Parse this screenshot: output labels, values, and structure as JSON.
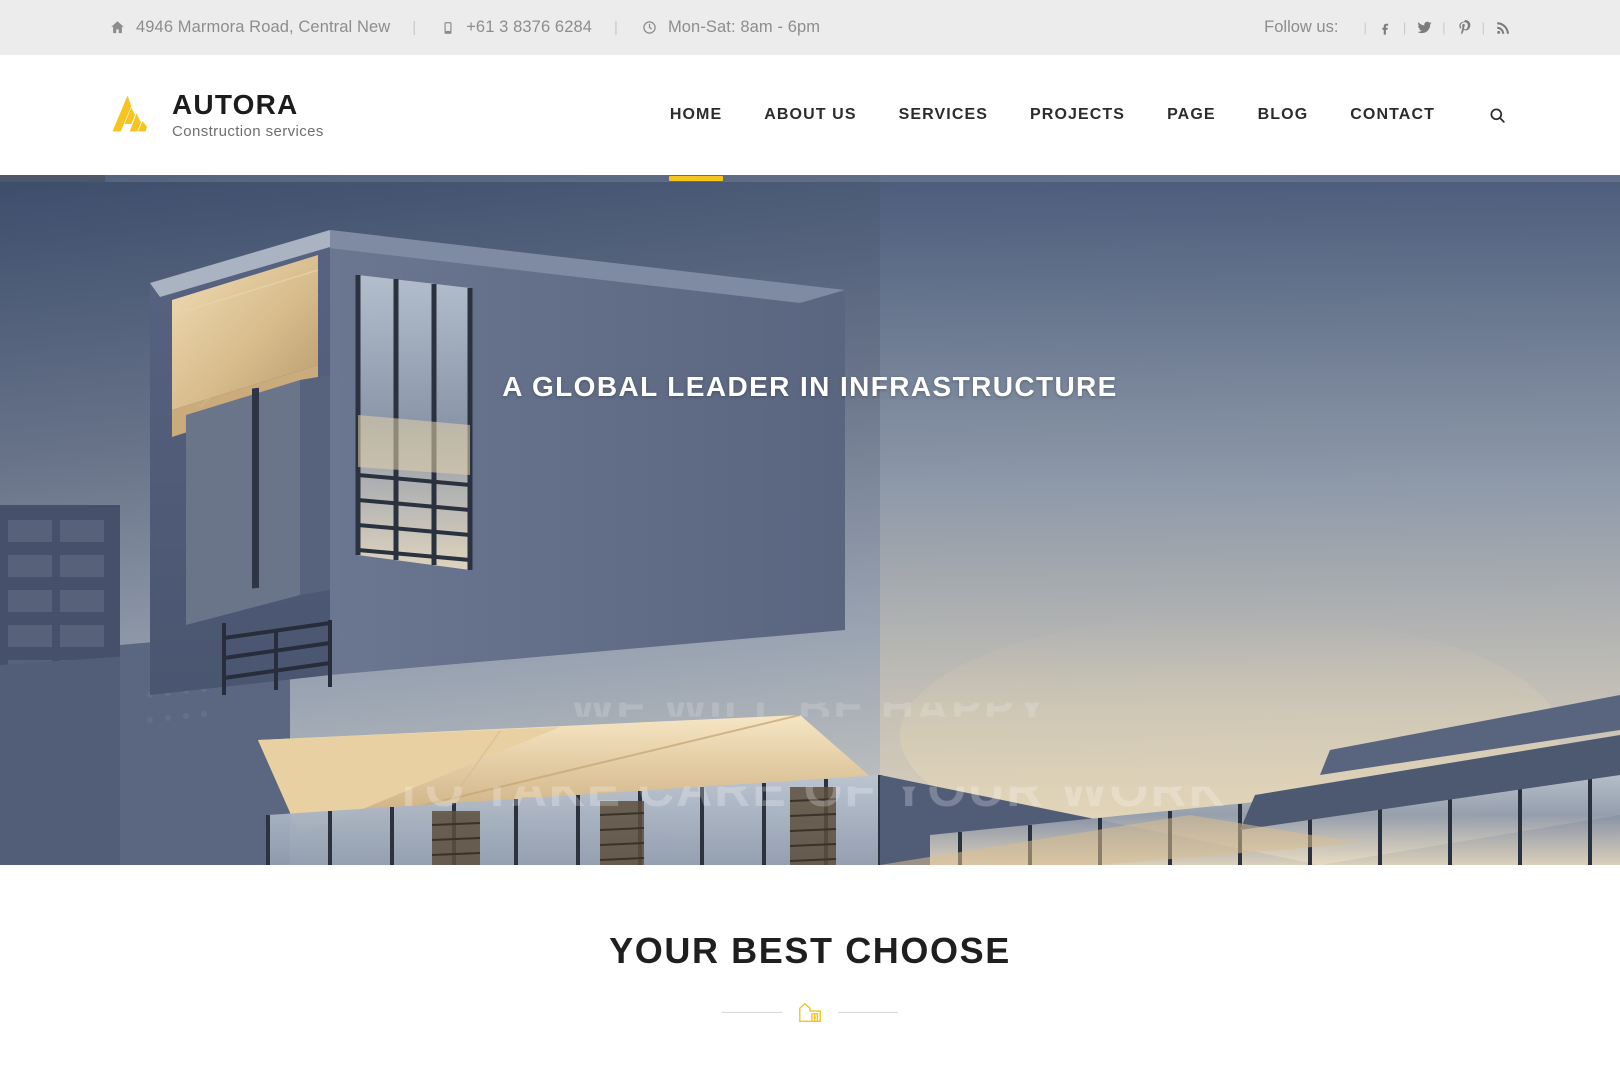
{
  "topbar": {
    "address": "4946 Marmora Road, Central New",
    "phone": "+61 3 8376 6284",
    "hours": "Mon-Sat: 8am - 6pm",
    "separator": "|",
    "follow_label": "Follow us:",
    "socials": [
      {
        "name": "facebook-icon",
        "glyph": "f"
      },
      {
        "name": "twitter-icon",
        "glyph": "t"
      },
      {
        "name": "pinterest-icon",
        "glyph": "P"
      },
      {
        "name": "rss-icon",
        "glyph": "r"
      }
    ],
    "icons": {
      "address": "home-icon",
      "phone": "phone-icon",
      "hours": "clock-icon"
    },
    "text_color": "#8d8d8d",
    "background": "#ececec"
  },
  "header": {
    "brand": "AUTORA",
    "tagline": "Construction services",
    "logo_color": "#f5c420",
    "nav": [
      {
        "label": "HOME",
        "active": true
      },
      {
        "label": "ABOUT US",
        "active": false
      },
      {
        "label": "SERVICES",
        "active": false
      },
      {
        "label": "PROJECTS",
        "active": false
      },
      {
        "label": "PAGE",
        "active": false
      },
      {
        "label": "BLOG",
        "active": false
      },
      {
        "label": "CONTACT",
        "active": false
      }
    ],
    "search_icon": "search-icon",
    "accent_color": "#f5c420"
  },
  "hero": {
    "headline": "A GLOBAL LEADER IN INFRASTRUCTURE",
    "sub_line_1": "WE WILL BE HAPPY",
    "sub_line_2": "TO TAKE CARE OF YOUR WORK",
    "slide_progress_percent": 6
  },
  "section": {
    "title": "YOUR BEST CHOOSE",
    "divider_icon": "building-house-icon",
    "divider_icon_color": "#f5c420"
  }
}
